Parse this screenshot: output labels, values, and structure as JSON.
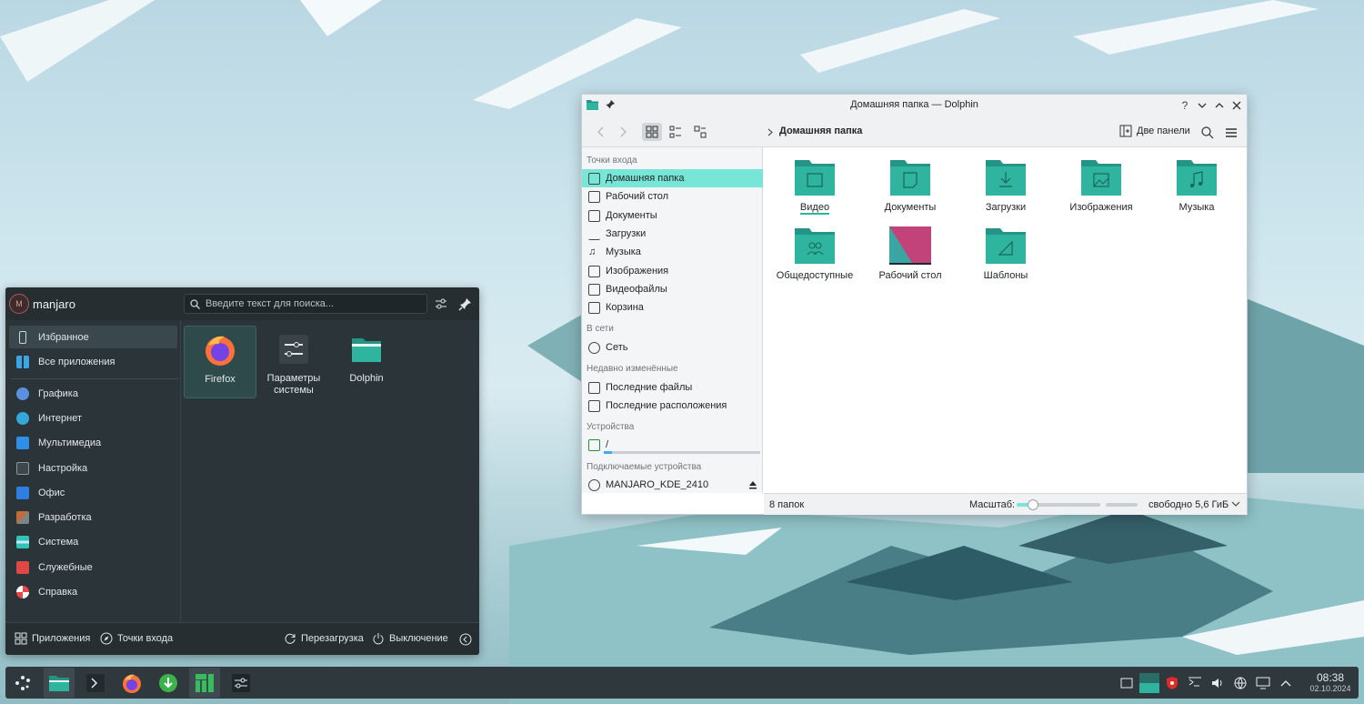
{
  "colors": {
    "accent": "#1abc9c",
    "folder": "#2fb59f",
    "folder_dark": "#249484",
    "place_selected": "#78e6d6"
  },
  "launcher": {
    "user": "manjaro",
    "search_placeholder": "Введите текст для поиска...",
    "categories": [
      {
        "label": "Избранное",
        "icon": "bookmark-icon"
      },
      {
        "label": "Все приложения",
        "icon": "grid-icon"
      },
      {
        "label": "Графика",
        "icon": "graphics-icon"
      },
      {
        "label": "Интернет",
        "icon": "globe-icon"
      },
      {
        "label": "Мультимедиа",
        "icon": "multimedia-icon"
      },
      {
        "label": "Настройка",
        "icon": "settings-icon"
      },
      {
        "label": "Офис",
        "icon": "office-icon"
      },
      {
        "label": "Разработка",
        "icon": "hammer-icon"
      },
      {
        "label": "Система",
        "icon": "system-icon"
      },
      {
        "label": "Служебные",
        "icon": "utilities-icon"
      },
      {
        "label": "Справка",
        "icon": "help-icon"
      }
    ],
    "favorites": [
      {
        "label": "Firefox",
        "icon": "firefox-icon"
      },
      {
        "label": "Параметры системы",
        "icon": "system-settings-icon"
      },
      {
        "label": "Dolphin",
        "icon": "folder-icon"
      }
    ],
    "footer": {
      "apps": "Приложения",
      "places": "Точки входа",
      "restart": "Перезагрузка",
      "shutdown": "Выключение"
    }
  },
  "dolphin": {
    "window_title": "Домашняя папка — Dolphin",
    "breadcrumb": "Домашняя папка",
    "two_panels": "Две панели",
    "places": {
      "entry_points_header": "Точки входа",
      "entry_points": [
        "Домашняя папка",
        "Рабочий стол",
        "Документы",
        "Загрузки",
        "Музыка",
        "Изображения",
        "Видеофайлы",
        "Корзина"
      ],
      "network_header": "В сети",
      "network": [
        "Сеть"
      ],
      "recent_header": "Недавно изменённые",
      "recent": [
        "Последние файлы",
        "Последние расположения"
      ],
      "devices_header": "Устройства",
      "devices": [
        "/"
      ],
      "removable_header": "Подключаемые устройства",
      "removable": [
        "MANJARO_KDE_2410"
      ]
    },
    "items": [
      {
        "label": "Видео",
        "icon": "film-icon"
      },
      {
        "label": "Документы",
        "icon": "document-icon"
      },
      {
        "label": "Загрузки",
        "icon": "download-icon"
      },
      {
        "label": "Изображения",
        "icon": "image-icon"
      },
      {
        "label": "Музыка",
        "icon": "music-icon"
      },
      {
        "label": "Общедоступные",
        "icon": "users-icon"
      },
      {
        "label": "Рабочий стол",
        "icon": "desktop-folder-icon"
      },
      {
        "label": "Шаблоны",
        "icon": "template-icon"
      }
    ],
    "status": {
      "count": "8 папок",
      "zoom_label": "Масштаб:",
      "free_space": "свободно 5,6 ГиБ",
      "zoom_fraction": 0.2,
      "disk_used_fraction": 0.05
    }
  },
  "taskbar": {
    "time": "08:38",
    "date": "02.10.2024"
  }
}
